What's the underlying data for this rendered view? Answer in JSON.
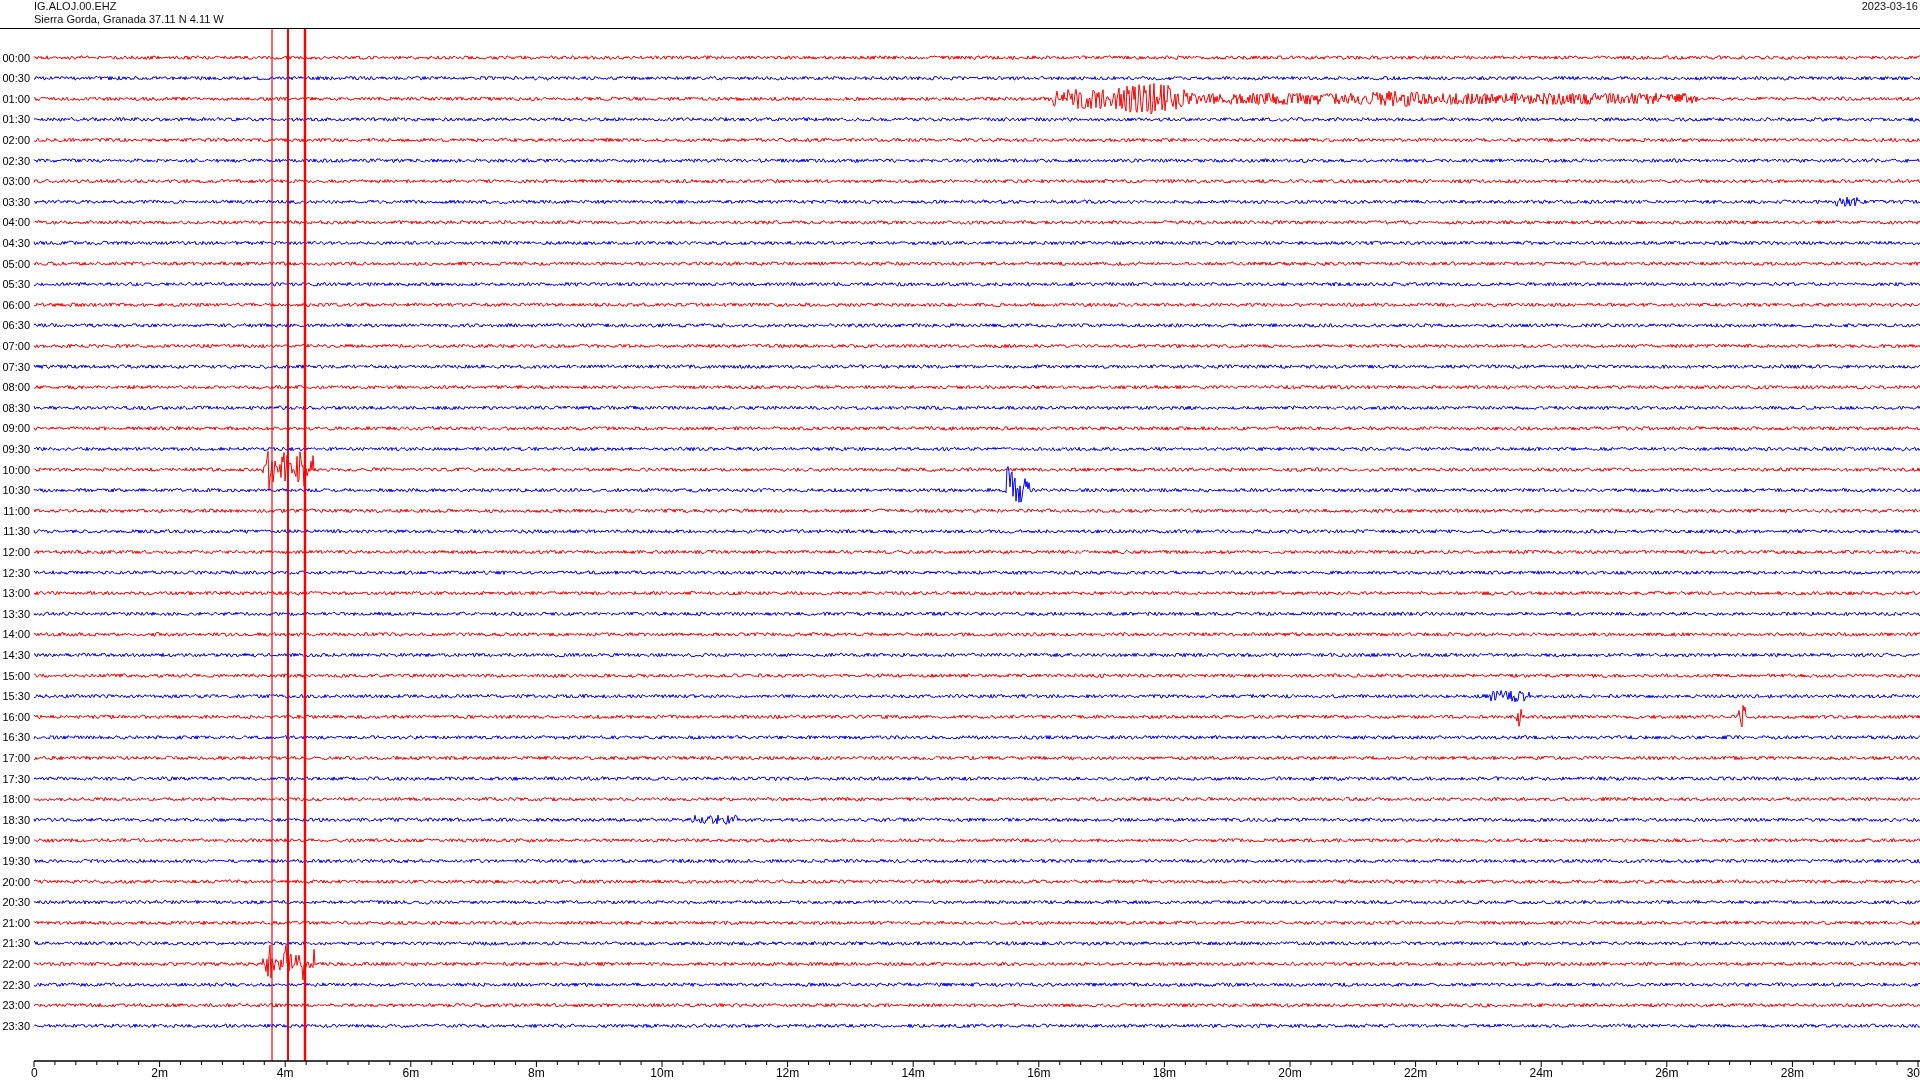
{
  "header": {
    "channel": "IG.ALOJ.00.EHZ",
    "location": "Sierra Gorda, Granada  37.11 N 4.11 W",
    "date": "2023-03-16"
  },
  "rows": [
    {
      "label": "00:00",
      "color": "#ff0000"
    },
    {
      "label": "00:30",
      "color": "#0000ff"
    },
    {
      "label": "01:00",
      "color": "#ff0000"
    },
    {
      "label": "01:30",
      "color": "#0000ff"
    },
    {
      "label": "02:00",
      "color": "#ff0000"
    },
    {
      "label": "02:30",
      "color": "#0000ff"
    },
    {
      "label": "03:00",
      "color": "#ff0000"
    },
    {
      "label": "03:30",
      "color": "#0000ff"
    },
    {
      "label": "04:00",
      "color": "#ff0000"
    },
    {
      "label": "04:30",
      "color": "#0000ff"
    },
    {
      "label": "05:00",
      "color": "#ff0000"
    },
    {
      "label": "05:30",
      "color": "#0000ff"
    },
    {
      "label": "06:00",
      "color": "#ff0000"
    },
    {
      "label": "06:30",
      "color": "#0000ff"
    },
    {
      "label": "07:00",
      "color": "#ff0000"
    },
    {
      "label": "07:30",
      "color": "#0000ff"
    },
    {
      "label": "08:00",
      "color": "#ff0000"
    },
    {
      "label": "08:30",
      "color": "#0000ff"
    },
    {
      "label": "09:00",
      "color": "#ff0000"
    },
    {
      "label": "09:30",
      "color": "#0000ff"
    },
    {
      "label": "10:00",
      "color": "#ff0000"
    },
    {
      "label": "10:30",
      "color": "#0000ff"
    },
    {
      "label": "11:00",
      "color": "#ff0000"
    },
    {
      "label": "11:30",
      "color": "#0000ff"
    },
    {
      "label": "12:00",
      "color": "#ff0000"
    },
    {
      "label": "12:30",
      "color": "#0000ff"
    },
    {
      "label": "13:00",
      "color": "#ff0000"
    },
    {
      "label": "13:30",
      "color": "#0000ff"
    },
    {
      "label": "14:00",
      "color": "#ff0000"
    },
    {
      "label": "14:30",
      "color": "#0000ff"
    },
    {
      "label": "15:00",
      "color": "#ff0000"
    },
    {
      "label": "15:30",
      "color": "#0000ff"
    },
    {
      "label": "16:00",
      "color": "#ff0000"
    },
    {
      "label": "16:30",
      "color": "#0000ff"
    },
    {
      "label": "17:00",
      "color": "#ff0000"
    },
    {
      "label": "17:30",
      "color": "#0000ff"
    },
    {
      "label": "18:00",
      "color": "#ff0000"
    },
    {
      "label": "18:30",
      "color": "#0000ff"
    },
    {
      "label": "19:00",
      "color": "#ff0000"
    },
    {
      "label": "19:30",
      "color": "#0000ff"
    },
    {
      "label": "20:00",
      "color": "#ff0000"
    },
    {
      "label": "20:30",
      "color": "#0000ff"
    },
    {
      "label": "21:00",
      "color": "#ff0000"
    },
    {
      "label": "21:30",
      "color": "#0000ff"
    },
    {
      "label": "22:00",
      "color": "#ff0000"
    },
    {
      "label": "22:30",
      "color": "#0000ff"
    },
    {
      "label": "23:00",
      "color": "#ff0000"
    },
    {
      "label": "23:30",
      "color": "#0000ff"
    }
  ],
  "x_axis": {
    "labels": [
      "0",
      "2m",
      "4m",
      "6m",
      "8m",
      "10m",
      "12m",
      "14m",
      "16m",
      "18m",
      "20m",
      "22m",
      "24m",
      "26m",
      "28m",
      "30"
    ]
  }
}
